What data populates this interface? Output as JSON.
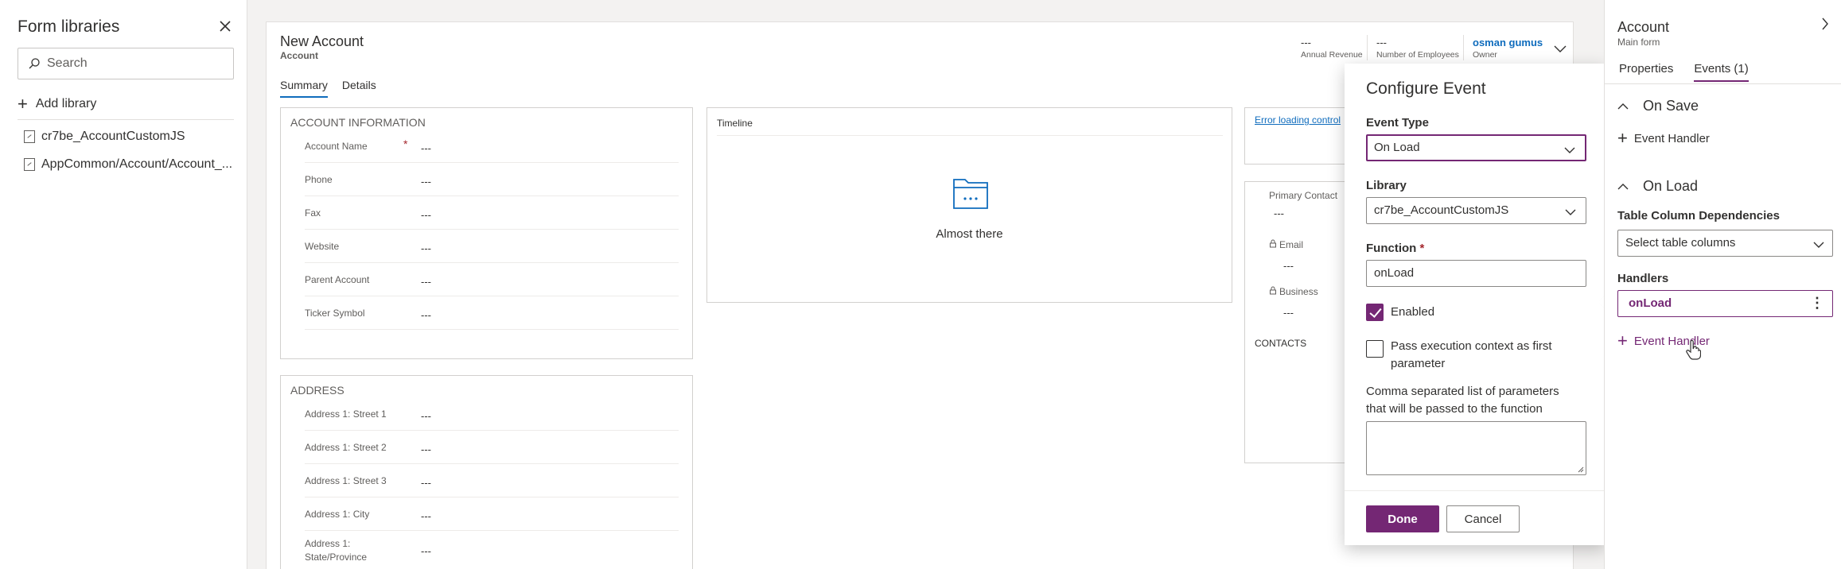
{
  "left_panel": {
    "title": "Form libraries",
    "search_placeholder": "Search",
    "add_library_label": "Add library",
    "libraries": [
      "cr7be_AccountCustomJS",
      "AppCommon/Account/Account_..."
    ]
  },
  "form": {
    "title": "New Account",
    "entity": "Account",
    "header_fields": [
      {
        "value": "---",
        "label": "Annual Revenue"
      },
      {
        "value": "---",
        "label": "Number of Employees"
      },
      {
        "value": "osman gumus",
        "label": "Owner"
      }
    ],
    "tabs": [
      "Summary",
      "Details"
    ],
    "account_info": {
      "title": "ACCOUNT INFORMATION",
      "fields": [
        {
          "label": "Account Name",
          "value": "---",
          "required_mark": "*"
        },
        {
          "label": "Phone",
          "value": "---"
        },
        {
          "label": "Fax",
          "value": "---"
        },
        {
          "label": "Website",
          "value": "---"
        },
        {
          "label": "Parent Account",
          "value": "---"
        },
        {
          "label": "Ticker Symbol",
          "value": "---"
        }
      ]
    },
    "address": {
      "title": "ADDRESS",
      "fields": [
        {
          "label": "Address 1: Street 1",
          "value": "---"
        },
        {
          "label": "Address 1: Street 2",
          "value": "---"
        },
        {
          "label": "Address 1: Street 3",
          "value": "---"
        },
        {
          "label": "Address 1: City",
          "value": "---"
        },
        {
          "label": "Address 1: State/Province",
          "value": "---"
        }
      ]
    },
    "timeline": {
      "title": "Timeline",
      "message": "Almost there"
    },
    "error_link": "Error loading control",
    "contact_card": {
      "primary_contact_label": "Primary Contact",
      "primary_contact_value": "---",
      "email_label": "Email",
      "email_value": "---",
      "business_label": "Business",
      "business_value": "---",
      "contacts_label": "CONTACTS"
    }
  },
  "dialog": {
    "title": "Configure Event",
    "event_type_label": "Event Type",
    "event_type_value": "On Load",
    "library_label": "Library",
    "library_value": "cr7be_AccountCustomJS",
    "function_label": "Function",
    "function_required": "*",
    "function_value": "onLoad",
    "enabled_label": "Enabled",
    "enabled_checked": true,
    "pass_context_label": "Pass execution context as first parameter",
    "pass_context_checked": false,
    "params_description": "Comma separated list of parameters that will be passed to the function",
    "params_value": "",
    "done_label": "Done",
    "cancel_label": "Cancel"
  },
  "right_panel": {
    "title": "Account",
    "subtitle": "Main form",
    "tabs": [
      "Properties",
      "Events (1)"
    ],
    "active_tab": "Events (1)",
    "on_save_label": "On Save",
    "on_save_event_handler_label": "Event Handler",
    "on_load_label": "On Load",
    "table_dependencies_label": "Table Column Dependencies",
    "table_dependencies_placeholder": "Select table columns",
    "handlers_label": "Handlers",
    "handler_item": "onLoad",
    "on_load_event_handler_label": "Event Handler"
  },
  "colors": {
    "accent": "#742774",
    "link": "#0f6cbd",
    "required": "#a4262c"
  }
}
